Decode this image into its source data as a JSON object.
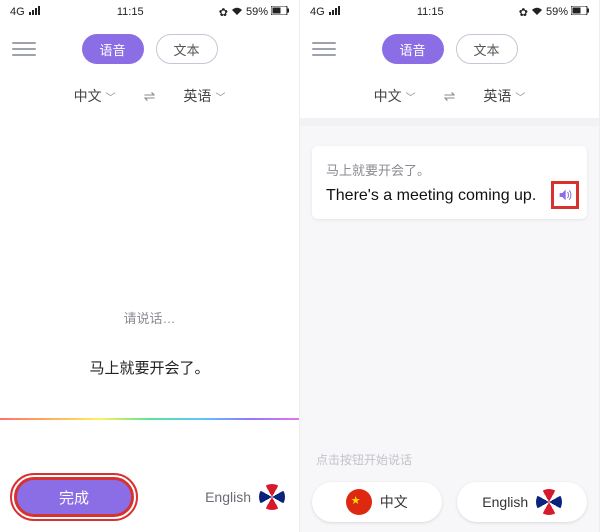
{
  "status": {
    "signal": "4G",
    "time": "11:15",
    "battery": "59%"
  },
  "header": {
    "tab_voice": "语音",
    "tab_text": "文本"
  },
  "langs": {
    "from": "中文",
    "to": "英语",
    "swap": "⇌"
  },
  "left": {
    "prompt": "请说话…",
    "recognized": "马上就要开会了。",
    "done": "完成",
    "english_label": "English"
  },
  "right": {
    "source": "马上就要开会了。",
    "target": "There's a meeting coming up.",
    "hint": "点击按钮开始说话",
    "chip_cn": "中文",
    "chip_en": "English"
  }
}
